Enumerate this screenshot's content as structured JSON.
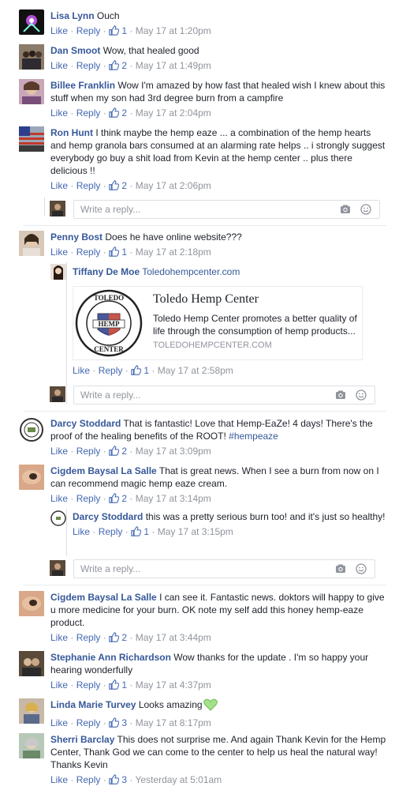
{
  "actions": {
    "like": "Like",
    "reply": "Reply",
    "sep": " · "
  },
  "reply_placeholder": "Write a reply...",
  "comments": [
    {
      "name": "Lisa Lynn",
      "text": "Ouch",
      "likes": "1",
      "time": "May 17 at 1:20pm"
    },
    {
      "name": "Dan Smoot",
      "text": "Wow, that healed good",
      "likes": "2",
      "time": "May 17 at 1:49pm"
    },
    {
      "name": "Billee Franklin",
      "text": "Wow I'm amazed by how fast that healed wish I knew about this stuff when my son had 3rd degree burn from a campfire",
      "likes": "2",
      "time": "May 17 at 2:04pm"
    },
    {
      "name": "Ron Hunt",
      "text": "I think maybe the hemp eaze ... a combination of the hemp hearts and hemp granola bars consumed at an alarming rate helps .. i strongly suggest everybody go buy a shit load from Kevin at the hemp center .. plus there delicious !!",
      "likes": "2",
      "time": "May 17 at 2:06pm"
    },
    {
      "name": "Penny Bost",
      "text": "Does he have online website???",
      "likes": "1",
      "time": "May 17 at 2:18pm"
    },
    {
      "name": "Tiffany De Moe",
      "text": "Toledohempcenter.com",
      "likes": "1",
      "time": "May 17 at 2:58pm"
    },
    {
      "name": "Darcy Stoddard",
      "text": "That is fantastic! Love that Hemp-EaZe! 4 days! There's the proof of the healing benefits of the ROOT!",
      "hashtag": "#hempeaze",
      "likes": "2",
      "time": "May 17 at 3:09pm"
    },
    {
      "name": "Cigdem Baysal La Salle",
      "text": "That is great news. When I see a burn from now on I can recommend magic hemp eaze cream.",
      "likes": "2",
      "time": "May 17 at 3:14pm"
    },
    {
      "name": "Darcy Stoddard",
      "text": "this was a pretty serious burn too! and it's just so healthy!",
      "likes": "1",
      "time": "May 17 at 3:15pm"
    },
    {
      "name": "Cigdem Baysal La Salle",
      "text": "I can see it. Fantastic news. doktors will happy to give u more medicine for your burn. OK note my self add this honey hemp-eaze product.",
      "likes": "2",
      "time": "May 17 at 3:44pm"
    },
    {
      "name": "Stephanie Ann Richardson",
      "text": "Wow thanks for the update . I'm so happy your hearing wonderfully",
      "likes": "1",
      "time": "May 17 at 4:37pm"
    },
    {
      "name": "Linda Marie Turvey",
      "text": "Looks amazing",
      "likes": "3",
      "time": "May 17 at 8:17pm"
    },
    {
      "name": "Sherri Barclay",
      "text": "This does not surprise me. And again Thank Kevin for the Hemp Center, Thank God we can come to the center to help us heal the natural way! Thanks Kevin",
      "likes": "3",
      "time": "Yesterday at 5:01am"
    }
  ],
  "link_preview": {
    "title": "Toledo Hemp Center",
    "description": "Toledo Hemp Center promotes a better quality of life through the consumption of hemp products...",
    "domain": "TOLEDOHEMPCENTER.COM",
    "logo_top": "TOLEDO",
    "logo_middle": "HEMP",
    "logo_bottom": "CENTER"
  },
  "colors": {
    "link": "#365899",
    "meta": "#90949c",
    "heart": "#a4e28a"
  },
  "icons": {
    "like": "thumbs-up-icon",
    "camera": "camera-icon",
    "emoji": "smiley-icon",
    "heart": "green-heart-icon"
  }
}
